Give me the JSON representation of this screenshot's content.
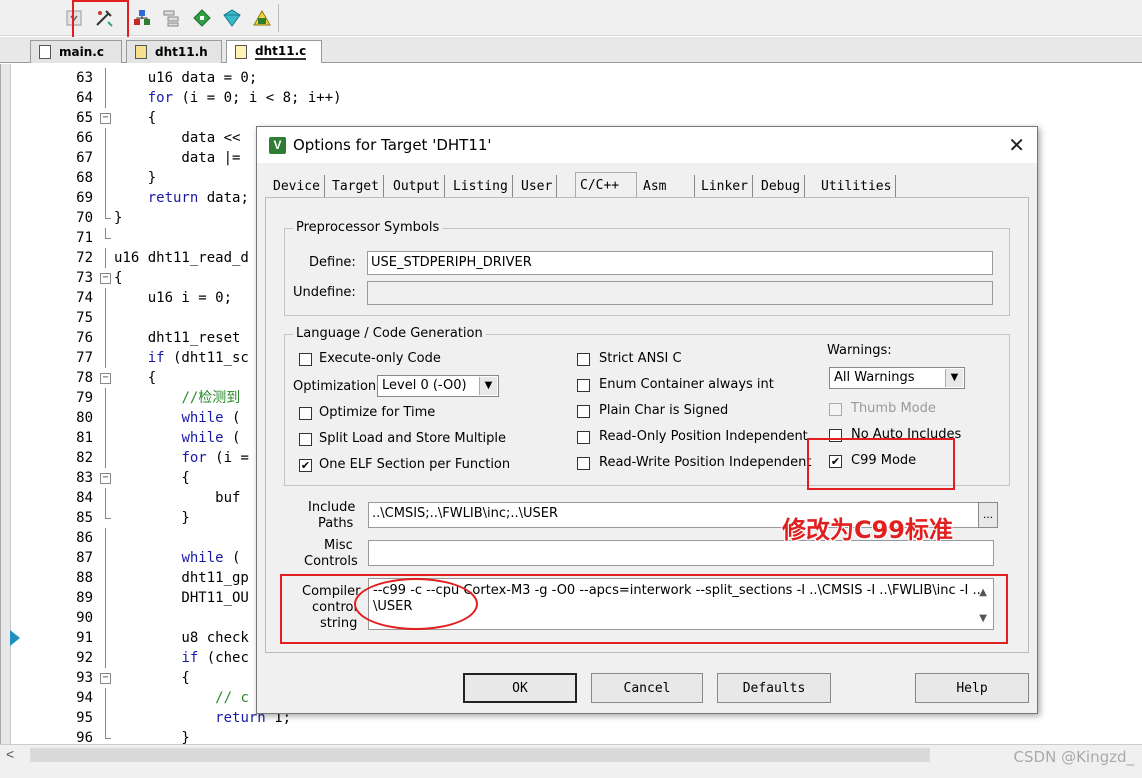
{
  "toolbar": {
    "icons": [
      "translate-dropdown-icon",
      "options-for-target-icon",
      "manage-components-icon",
      "pack-installer-icon",
      "select-packs-icon",
      "manage-run-time-env-icon",
      "software-packs-icon"
    ]
  },
  "tabs": [
    {
      "label": "main.c",
      "active": false
    },
    {
      "label": "dht11.h",
      "active": false
    },
    {
      "label": "dht11.c",
      "active": true
    }
  ],
  "editor": {
    "lines": [
      {
        "n": "63",
        "code": "    u16 data = 0;"
      },
      {
        "n": "64",
        "code": "    for (i = 0; i < 8; i++)"
      },
      {
        "n": "65",
        "code": "    {"
      },
      {
        "n": "66",
        "code": "        data <<"
      },
      {
        "n": "67",
        "code": "        data |="
      },
      {
        "n": "68",
        "code": "    }"
      },
      {
        "n": "69",
        "code": "    return data;"
      },
      {
        "n": "70",
        "code": "}"
      },
      {
        "n": "71",
        "code": ""
      },
      {
        "n": "72",
        "code": "u16 dht11_read_d"
      },
      {
        "n": "73",
        "code": "{"
      },
      {
        "n": "74",
        "code": "    u16 i = 0;"
      },
      {
        "n": "75",
        "code": ""
      },
      {
        "n": "76",
        "code": "    dht11_reset"
      },
      {
        "n": "77",
        "code": "    if (dht11_sc"
      },
      {
        "n": "78",
        "code": "    {"
      },
      {
        "n": "79",
        "code": "        //检测到"
      },
      {
        "n": "80",
        "code": "        while ("
      },
      {
        "n": "81",
        "code": "        while ("
      },
      {
        "n": "82",
        "code": "        for (i ="
      },
      {
        "n": "83",
        "code": "        {"
      },
      {
        "n": "84",
        "code": "            buf"
      },
      {
        "n": "85",
        "code": "        }"
      },
      {
        "n": "86",
        "code": ""
      },
      {
        "n": "87",
        "code": "        while ("
      },
      {
        "n": "88",
        "code": "        dht11_gp"
      },
      {
        "n": "89",
        "code": "        DHT11_OU"
      },
      {
        "n": "90",
        "code": ""
      },
      {
        "n": "91",
        "code": "        u8 check"
      },
      {
        "n": "92",
        "code": "        if (chec"
      },
      {
        "n": "93",
        "code": "        {"
      },
      {
        "n": "94",
        "code": "            // c"
      },
      {
        "n": "95",
        "code": "            return 1;"
      },
      {
        "n": "96",
        "code": "        }"
      }
    ]
  },
  "dialog": {
    "title": "Options for Target 'DHT11'",
    "close_label": "✕",
    "tabs": [
      "Device",
      "Target",
      "Output",
      "Listing",
      "User",
      "C/C++",
      "Asm",
      "Linker",
      "Debug",
      "Utilities"
    ],
    "active_tab": "C/C++",
    "preprocessor": {
      "group_title": "Preprocessor Symbols",
      "define_label": "Define:",
      "define_value": "USE_STDPERIPH_DRIVER",
      "undefine_label": "Undefine:",
      "undefine_value": ""
    },
    "language": {
      "group_title": "Language / Code Generation",
      "execute_only": {
        "label": "Execute-only Code",
        "checked": false
      },
      "optimization_label": "Optimization:",
      "optimization_value": "Level 0 (-O0)",
      "optimize_time": {
        "label": "Optimize for Time",
        "checked": false
      },
      "split_load": {
        "label": "Split Load and Store Multiple",
        "checked": false
      },
      "one_elf": {
        "label": "One ELF Section per Function",
        "checked": true
      },
      "strict_ansi": {
        "label": "Strict ANSI C",
        "checked": false
      },
      "enum_container": {
        "label": "Enum Container always int",
        "checked": false
      },
      "plain_char": {
        "label": "Plain Char is Signed",
        "checked": false
      },
      "ro_pi": {
        "label": "Read-Only Position Independent",
        "checked": false
      },
      "rw_pi": {
        "label": "Read-Write Position Independent",
        "checked": false
      },
      "warnings_label": "Warnings:",
      "warnings_value": "All Warnings",
      "thumb_mode": {
        "label": "Thumb Mode",
        "checked": false
      },
      "no_auto_includes": {
        "label": "No Auto Includes",
        "checked": false
      },
      "c99_mode": {
        "label": "C99 Mode",
        "checked": true
      }
    },
    "include_paths_label_1": "Include",
    "include_paths_label_2": "Paths",
    "include_paths_value": "..\\CMSIS;..\\FWLIB\\inc;..\\USER",
    "include_browse": "...",
    "misc_label_1": "Misc",
    "misc_label_2": "Controls",
    "misc_value": "",
    "compiler_label_1": "Compiler",
    "compiler_label_2": "control",
    "compiler_label_3": "string",
    "compiler_line_1": "--c99 -c --cpu Cortex-M3 -g -O0 --apcs=interwork --split_sections -I ..\\CMSIS -I ..\\FWLIB\\inc -I ..",
    "compiler_line_2": "\\USER",
    "buttons": {
      "ok": "OK",
      "cancel": "Cancel",
      "defaults": "Defaults",
      "help": "Help"
    }
  },
  "annotation": {
    "text": "修改为C99标准",
    "color": "#e02020"
  },
  "watermark": "CSDN @Kingzd_"
}
